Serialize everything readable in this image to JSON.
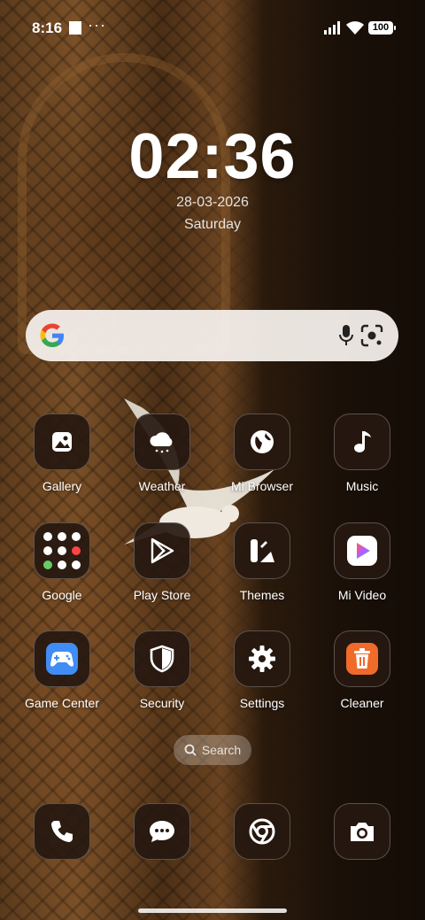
{
  "status_bar": {
    "time": "8:16",
    "battery": "100",
    "more_indicator": "···"
  },
  "clock_widget": {
    "time": "02:36",
    "date": "28-03-2026",
    "day": "Saturday"
  },
  "search_widget": {
    "icons": [
      "google-logo",
      "microphone-icon",
      "google-lens-icon"
    ]
  },
  "apps": [
    {
      "label": "Gallery",
      "icon": "gallery-icon"
    },
    {
      "label": "Weather",
      "icon": "weather-icon"
    },
    {
      "label": "Mi Browser",
      "icon": "globe-icon"
    },
    {
      "label": "Music",
      "icon": "music-note-icon"
    },
    {
      "label": "Google",
      "icon": "google-folder-icon"
    },
    {
      "label": "Play Store",
      "icon": "play-store-icon"
    },
    {
      "label": "Themes",
      "icon": "themes-icon"
    },
    {
      "label": "Mi Video",
      "icon": "mi-video-icon"
    },
    {
      "label": "Game Center",
      "icon": "gamepad-icon"
    },
    {
      "label": "Security",
      "icon": "shield-icon"
    },
    {
      "label": "Settings",
      "icon": "gear-icon"
    },
    {
      "label": "Cleaner",
      "icon": "trash-icon"
    }
  ],
  "app_search": {
    "label": "Search"
  },
  "dock": [
    {
      "icon": "phone-icon"
    },
    {
      "icon": "messages-icon"
    },
    {
      "icon": "chrome-icon"
    },
    {
      "icon": "camera-icon"
    }
  ],
  "colors": {
    "tile_background": "#261810",
    "search_bar_background": "#f5f0ec",
    "game_center_blue": "#3f8df5",
    "cleaner_orange": "#f06a2a"
  }
}
